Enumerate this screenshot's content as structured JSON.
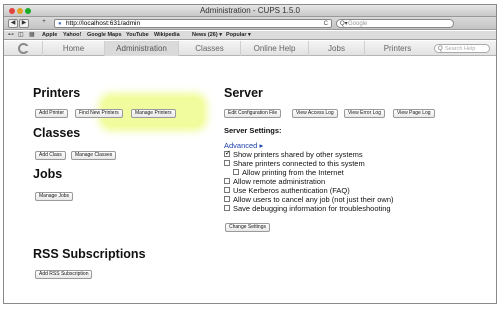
{
  "window": {
    "title": "Administration - CUPS 1.5.0"
  },
  "toolbar": {
    "back_icon": "back-arrow-icon",
    "forward_icon": "forward-arrow-icon",
    "add_icon": "+",
    "url": "http://localhost:631/admin",
    "reload_icon": "C",
    "search_placeholder": "Google"
  },
  "bookmarks": {
    "items": [
      "Apple",
      "Yahoo!",
      "Google Maps",
      "YouTube",
      "Wikipedia",
      "News (26) ▾",
      "Popular ▾"
    ]
  },
  "nav": {
    "tabs": [
      "Home",
      "Administration",
      "Classes",
      "Online Help",
      "Jobs",
      "Printers"
    ],
    "active": "Administration",
    "search_placeholder": "Search Help"
  },
  "printers": {
    "heading": "Printers",
    "buttons": [
      "Add Printer",
      "Find New Printers",
      "Manage Printers"
    ]
  },
  "classes": {
    "heading": "Classes",
    "buttons": [
      "Add Class",
      "Manage Classes"
    ]
  },
  "jobs": {
    "heading": "Jobs",
    "buttons": [
      "Manage Jobs"
    ]
  },
  "rss": {
    "heading": "RSS Subscriptions",
    "buttons": [
      "Add RSS Subscription"
    ]
  },
  "server": {
    "heading": "Server",
    "buttons": [
      "Edit Configuration File",
      "View Access Log",
      "View Error Log",
      "View Page Log"
    ],
    "settings_label": "Server Settings:",
    "advanced_label": "Advanced ▸",
    "options": [
      {
        "label": "Show printers shared by other systems",
        "checked": true
      },
      {
        "label": "Share printers connected to this system",
        "checked": false
      },
      {
        "label": "Allow printing from the Internet",
        "checked": false
      },
      {
        "label": "Allow remote administration",
        "checked": false
      },
      {
        "label": "Use Kerberos authentication (FAQ)",
        "checked": false
      },
      {
        "label": "Allow users to cancel any job (not just their own)",
        "checked": false
      },
      {
        "label": "Save debugging information for troubleshooting",
        "checked": false
      }
    ],
    "change_button": "Change Settings"
  },
  "colors": {
    "highlight": "#e6fa50",
    "link": "#1a3fa8"
  }
}
